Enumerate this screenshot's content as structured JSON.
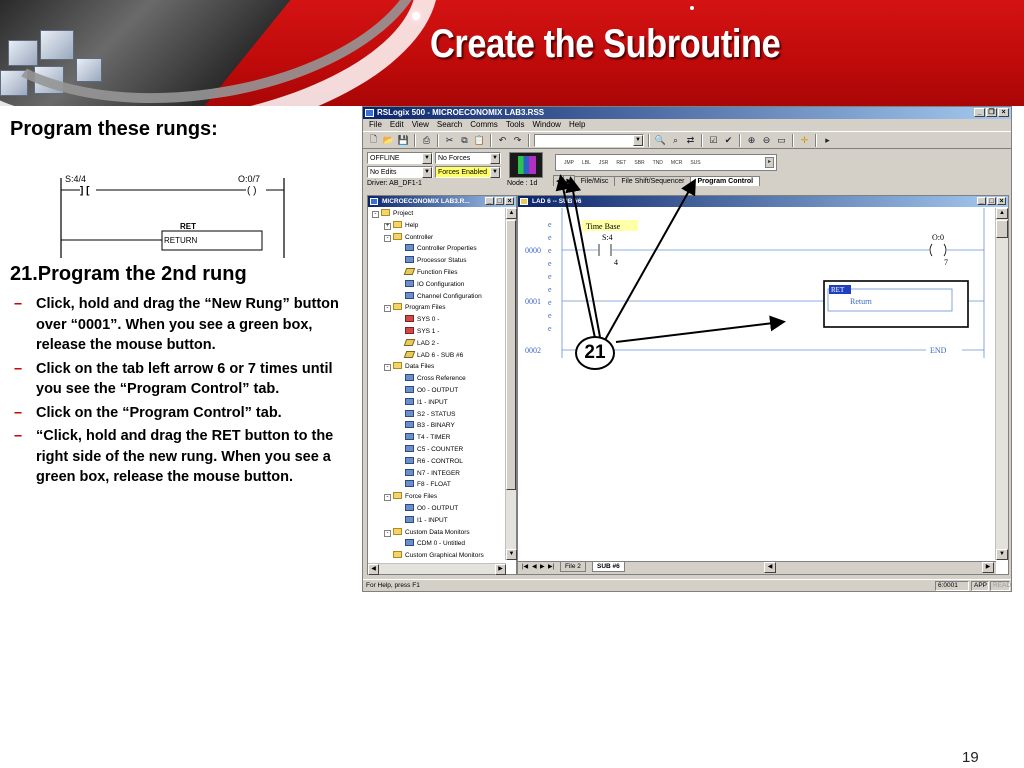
{
  "slide": {
    "title": "Create the Subroutine",
    "page_number": "19"
  },
  "left": {
    "heading": "Program these rungs:",
    "mini_ladder": {
      "input_address": "S:4/4",
      "input_symbol": "] [",
      "output_address": "O:0/7",
      "output_symbol": "( )",
      "ret_short": "RET",
      "ret_long": "RETURN"
    },
    "step_heading": "21.Program the 2nd rung",
    "bullets": [
      "Click, hold and drag the “New Rung” button over “0001”. When you see a green box, release the mouse button.",
      "Click on the tab left arrow 6 or 7 times until you see the “Program Control” tab.",
      "Click on the “Program Control” tab.",
      "“Click, hold and drag the RET button to the right side of the new rung. When you see a green box, release the mouse button."
    ]
  },
  "app": {
    "title": "RSLogix 500 - MICROECONOMIX LAB3.RSS",
    "menu": [
      "File",
      "Edit",
      "View",
      "Search",
      "Comms",
      "Tools",
      "Window",
      "Help"
    ],
    "status": {
      "mode": "OFFLINE",
      "forces": "No Forces",
      "edits": "No Edits",
      "forces_enabled": "Forces Enabled",
      "driver": "Driver: AB_DF1-1",
      "node": "Node : 1d"
    },
    "instruction_palette": [
      "JMP",
      "LBL",
      "JSR",
      "RET",
      "SBR",
      "TND",
      "MCR",
      "SUS"
    ],
    "instruction_tabs": [
      "File/Misc",
      "File Shift/Sequencer",
      "Program Control"
    ],
    "project_window_title": "MICROECONOMIX LAB3.R...",
    "tree": [
      {
        "label": "Project",
        "level": 0,
        "icon": "folder",
        "exp": "-"
      },
      {
        "label": "Help",
        "level": 1,
        "icon": "folder",
        "exp": "+"
      },
      {
        "label": "Controller",
        "level": 1,
        "icon": "folder",
        "exp": "-"
      },
      {
        "label": "Controller Properties",
        "level": 2,
        "icon": "file"
      },
      {
        "label": "Processor Status",
        "level": 2,
        "icon": "file"
      },
      {
        "label": "Function Files",
        "level": 2,
        "icon": "lad"
      },
      {
        "label": "IO Configuration",
        "level": 2,
        "icon": "file"
      },
      {
        "label": "Channel Configuration",
        "level": 2,
        "icon": "file"
      },
      {
        "label": "Program Files",
        "level": 1,
        "icon": "folder",
        "exp": "-"
      },
      {
        "label": "SYS 0 -",
        "level": 2,
        "icon": "red"
      },
      {
        "label": "SYS 1 -",
        "level": 2,
        "icon": "red"
      },
      {
        "label": "LAD 2 -",
        "level": 2,
        "icon": "lad"
      },
      {
        "label": "LAD 6 - SUB #6",
        "level": 2,
        "icon": "lad"
      },
      {
        "label": "Data Files",
        "level": 1,
        "icon": "folder",
        "exp": "-"
      },
      {
        "label": "Cross Reference",
        "level": 2,
        "icon": "file"
      },
      {
        "label": "O0 - OUTPUT",
        "level": 2,
        "icon": "file"
      },
      {
        "label": "I1 - INPUT",
        "level": 2,
        "icon": "file"
      },
      {
        "label": "S2 - STATUS",
        "level": 2,
        "icon": "file"
      },
      {
        "label": "B3 - BINARY",
        "level": 2,
        "icon": "file"
      },
      {
        "label": "T4 - TIMER",
        "level": 2,
        "icon": "file"
      },
      {
        "label": "C5 - COUNTER",
        "level": 2,
        "icon": "file"
      },
      {
        "label": "R6 - CONTROL",
        "level": 2,
        "icon": "file"
      },
      {
        "label": "N7 - INTEGER",
        "level": 2,
        "icon": "file"
      },
      {
        "label": "F8 - FLOAT",
        "level": 2,
        "icon": "file"
      },
      {
        "label": "Force Files",
        "level": 1,
        "icon": "folder",
        "exp": "-"
      },
      {
        "label": "O0 - OUTPUT",
        "level": 2,
        "icon": "file"
      },
      {
        "label": "I1 - INPUT",
        "level": 2,
        "icon": "file"
      },
      {
        "label": "Custom Data Monitors",
        "level": 1,
        "icon": "folder",
        "exp": "-"
      },
      {
        "label": "CDM 0 - Untitled",
        "level": 2,
        "icon": "file"
      },
      {
        "label": "Custom Graphical Monitors",
        "level": 1,
        "icon": "folder"
      }
    ],
    "ladder_window_title": "LAD 6 -- SUB #6",
    "ladder": {
      "rung_numbers": [
        "0000",
        "0001",
        "0002"
      ],
      "e_markers": [
        "e",
        "e",
        "e",
        "e",
        "e",
        "e",
        "e",
        "e",
        "e"
      ],
      "time_base": "Time Base",
      "contact_address": "S:4",
      "contact_bit": "4",
      "coil_address": "O:0",
      "coil_bit": "7",
      "ret_label": "RET",
      "ret_desc": "Return",
      "end_label": "END"
    },
    "ladder_tabs": [
      "File 2",
      "SUB #6"
    ],
    "statusbar": {
      "help": "For Help, press F1",
      "position": "6:0001",
      "app": "APP",
      "read": "READ"
    }
  },
  "callout": "21"
}
